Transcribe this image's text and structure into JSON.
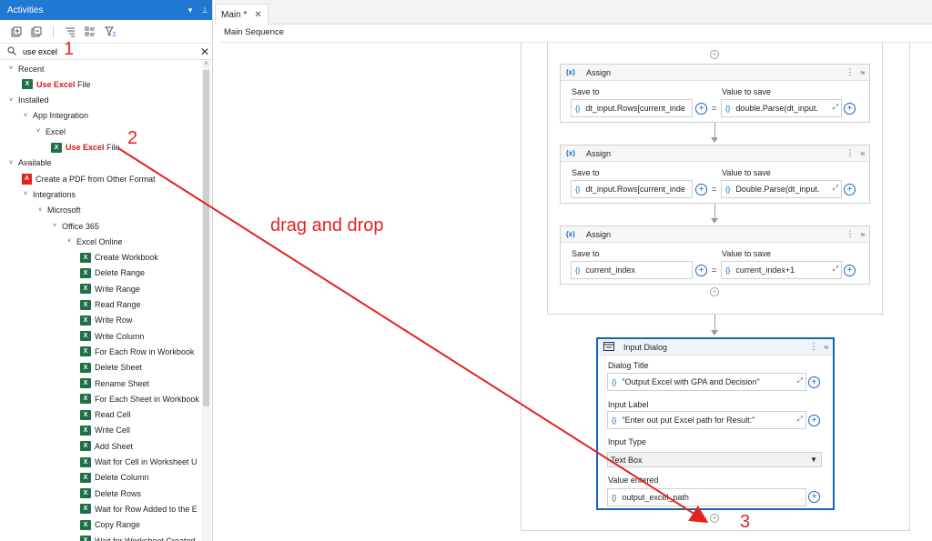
{
  "activities_panel": {
    "title": "Activities",
    "search_value": "use excel",
    "tree": [
      {
        "label": "Recent",
        "chevron": "˅"
      },
      {
        "label_hl": "Use Excel",
        "label": " File",
        "icon": "excel-icon"
      },
      {
        "label": "Installed",
        "chevron": "˅"
      },
      {
        "label": "App Integration",
        "chevron": "˅"
      },
      {
        "label": "Excel",
        "chevron": "˅"
      },
      {
        "label_hl": "Use Excel",
        "label": " File",
        "icon": "excel-icon"
      },
      {
        "label": "Available",
        "chevron": "˅"
      },
      {
        "label": "Create a PDF from Other Format",
        "icon": "pdf-icon"
      },
      {
        "label": "Integrations",
        "chevron": "˅"
      },
      {
        "label": "Microsoft",
        "chevron": "˅"
      },
      {
        "label": "Office 365",
        "chevron": "˅"
      },
      {
        "label": "Excel Online",
        "chevron": "˅"
      },
      {
        "label": "Create Workbook",
        "icon": "excel-icon"
      },
      {
        "label": "Delete Range",
        "icon": "excel-icon"
      },
      {
        "label": "Write Range",
        "icon": "excel-icon"
      },
      {
        "label": "Read Range",
        "icon": "excel-icon"
      },
      {
        "label": "Write Row",
        "icon": "excel-icon"
      },
      {
        "label": "Write Column",
        "icon": "excel-icon"
      },
      {
        "label": "For Each Row in Workbook",
        "icon": "excel-icon"
      },
      {
        "label": "Delete Sheet",
        "icon": "excel-icon"
      },
      {
        "label": "Rename Sheet",
        "icon": "excel-icon"
      },
      {
        "label": "For Each Sheet in Workbook",
        "icon": "excel-icon"
      },
      {
        "label": "Read Cell",
        "icon": "excel-icon"
      },
      {
        "label": "Write Cell",
        "icon": "excel-icon"
      },
      {
        "label": "Add Sheet",
        "icon": "excel-icon"
      },
      {
        "label": "Wait for Cell in Worksheet U",
        "icon": "excel-icon"
      },
      {
        "label": "Delete Column",
        "icon": "excel-icon"
      },
      {
        "label": "Delete Rows",
        "icon": "excel-icon"
      },
      {
        "label": "Wait for Row Added to the E",
        "icon": "excel-icon"
      },
      {
        "label": "Copy Range",
        "icon": "excel-icon"
      },
      {
        "label": "Wait for Worksheet Created",
        "icon": "excel-icon"
      }
    ]
  },
  "tabs": {
    "main": "Main *",
    "close": "✕"
  },
  "breadcrumb": "Main Sequence",
  "assign_cards": [
    {
      "title": "Assign",
      "save_to_label": "Save to",
      "value_label": "Value to save",
      "save_to": "dt_input.Rows[current_inde",
      "value": "double.Parse(dt_input."
    },
    {
      "title": "Assign",
      "save_to_label": "Save to",
      "value_label": "Value to save",
      "save_to": "dt_input.Rows[current_inde",
      "value": "Double.Parse(dt_input."
    },
    {
      "title": "Assign",
      "save_to_label": "Save to",
      "value_label": "Value to save",
      "save_to": "current_index",
      "value": "current_index+1"
    }
  ],
  "input_dialog": {
    "title": "Input Dialog",
    "dialog_title_label": "Dialog Title",
    "dialog_title_value": "\"Output Excel with GPA and Decision\"",
    "input_label_label": "Input Label",
    "input_label_value": "\"Enter out put Excel path for Result:\"",
    "input_type_label": "Input Type",
    "input_type_value": "Text Box",
    "value_entered_label": "Value entered",
    "value_entered_value": "output_excel_path"
  },
  "annotations": {
    "step1": "1",
    "step2": "2",
    "step3": "3",
    "drag_text": "drag and drop"
  },
  "colors": {
    "accent": "#1f78d1",
    "annotation": "#e52222",
    "excel": "#1e7145",
    "selected_border": "#1565c0"
  }
}
